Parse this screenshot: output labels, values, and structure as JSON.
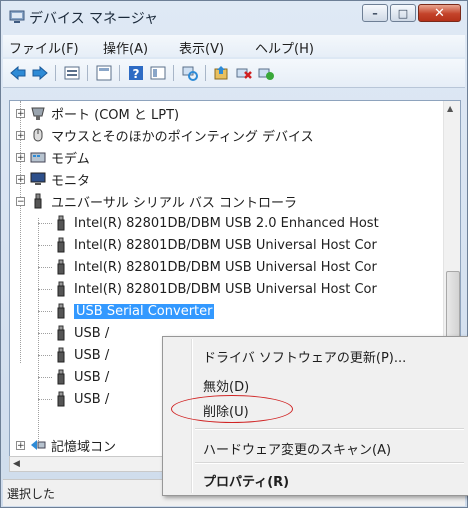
{
  "window": {
    "title": "デバイス マネージャ",
    "caption_buttons": {
      "minimize": "–",
      "maximize": "□",
      "close": "✕"
    }
  },
  "menubar": {
    "items": [
      {
        "label": "ファイル(F)"
      },
      {
        "label": "操作(A)"
      },
      {
        "label": "表示(V)"
      },
      {
        "label": "ヘルプ(H)"
      }
    ]
  },
  "toolbar": {
    "icons": [
      "back-icon",
      "forward-icon",
      "properties-icon",
      "view-icon",
      "help-icon",
      "details-icon",
      "scan-icon",
      "update-driver-icon",
      "uninstall-icon",
      "enable-icon"
    ]
  },
  "tree": {
    "items": [
      {
        "label": "ポート (COM と LPT)",
        "expander": "+",
        "icon": "port-icon"
      },
      {
        "label": "マウスとそのほかのポインティング デバイス",
        "expander": "+",
        "icon": "mouse-icon"
      },
      {
        "label": "モデム",
        "expander": "+",
        "icon": "modem-icon"
      },
      {
        "label": "モニタ",
        "expander": "+",
        "icon": "monitor-icon"
      },
      {
        "label": "ユニバーサル シリアル バス コントローラ",
        "expander": "−",
        "icon": "usb-icon"
      },
      {
        "label": "Intel(R) 82801DB/DBM USB 2.0 Enhanced Host",
        "icon": "usb-device-icon"
      },
      {
        "label": "Intel(R) 82801DB/DBM USB Universal Host Cor",
        "icon": "usb-device-icon"
      },
      {
        "label": "Intel(R) 82801DB/DBM USB Universal Host Cor",
        "icon": "usb-device-icon"
      },
      {
        "label": "Intel(R) 82801DB/DBM USB Universal Host Cor",
        "icon": "usb-device-icon"
      },
      {
        "label": "USB Serial Converter",
        "icon": "usb-device-icon",
        "selected": true
      },
      {
        "label": "USB /",
        "icon": "usb-device-icon"
      },
      {
        "label": "USB /",
        "icon": "usb-device-icon"
      },
      {
        "label": "USB /",
        "icon": "usb-device-icon"
      },
      {
        "label": "USB /",
        "icon": "usb-device-icon"
      },
      {
        "label": "記憶域コン",
        "expander": "+",
        "icon": "storage-icon"
      }
    ]
  },
  "context_menu": {
    "items": [
      {
        "label": "ドライバ ソフトウェアの更新(P)..."
      },
      {
        "label": "無効(D)"
      },
      {
        "label": "削除(U)",
        "highlighted_by_annotation": true
      },
      {
        "label": "ハードウェア変更のスキャン(A)"
      },
      {
        "label": "プロパティ(R)",
        "bold": true
      }
    ],
    "annotation_color": "#d02424"
  },
  "statusbar": {
    "text": "選択した"
  },
  "colors": {
    "selection": "#3399ff",
    "frame": "#dfe9f5"
  }
}
